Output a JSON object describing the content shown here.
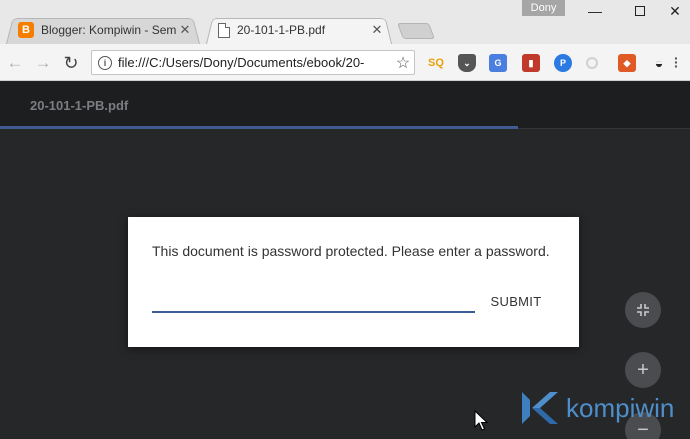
{
  "tabs": [
    {
      "label": "Blogger: Kompiwin - Sem",
      "icon": "blogger-icon",
      "active": false
    },
    {
      "label": "20-101-1-PB.pdf",
      "icon": "document-icon",
      "active": true
    }
  ],
  "window": {
    "profile_name": "Dony"
  },
  "toolbar": {
    "url": "file:///C:/Users/Dony/Documents/ebook/20-",
    "extensions": [
      "sq-icon",
      "pocket-icon",
      "google-translate-icon",
      "book-icon",
      "p-icon",
      "circle-icon",
      "red-ext-icon",
      "mask-icon"
    ]
  },
  "viewer": {
    "title": "20-101-1-PB.pdf",
    "load_progress": 0.75
  },
  "dialog": {
    "message": "This document is password protected. Please enter a password.",
    "password_value": "",
    "submit_label": "SUBMIT"
  },
  "watermark": {
    "text": "kompiwin"
  },
  "colors": {
    "accent": "#3d5d99",
    "viewer_bg": "#262729",
    "watermark": "#4e8fcb"
  }
}
